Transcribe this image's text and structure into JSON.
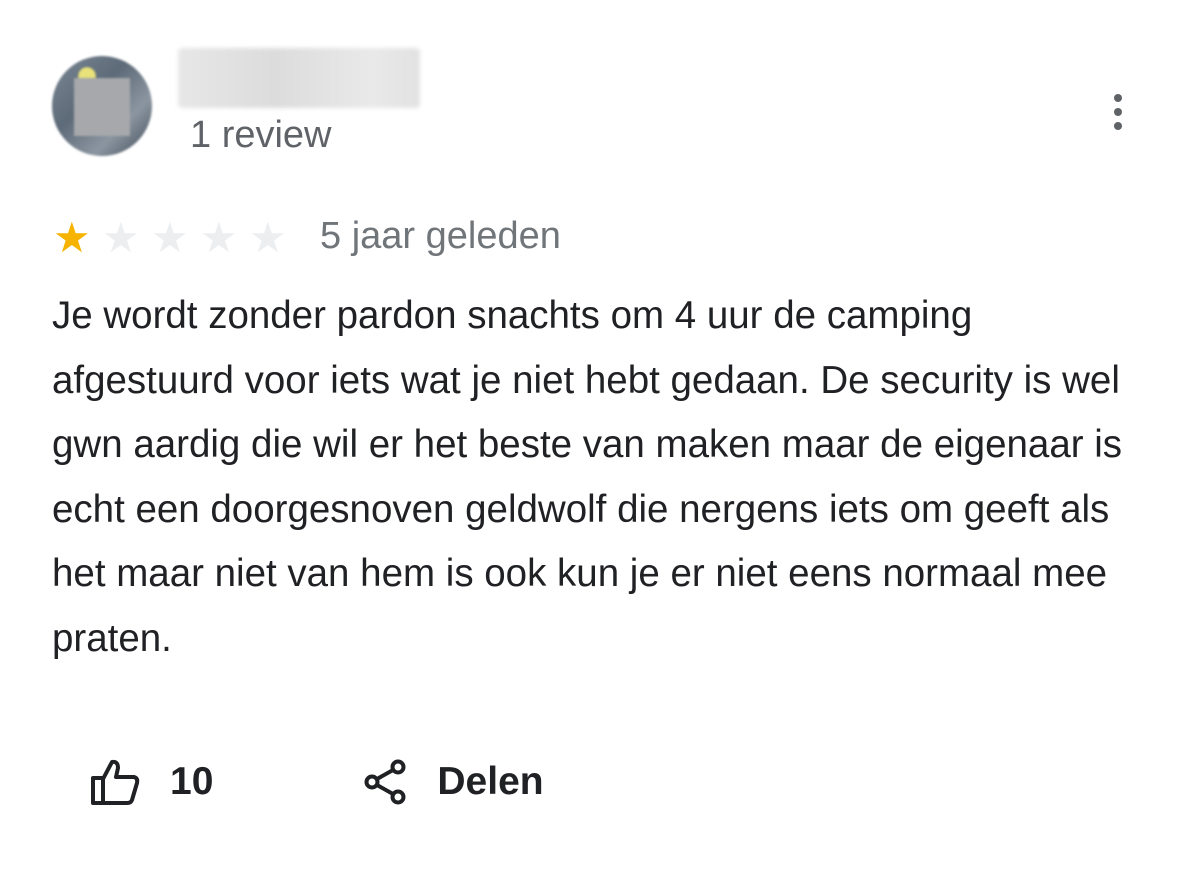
{
  "reviewer": {
    "avatar_icon": "blurred-profile-photo",
    "review_count": "1 review"
  },
  "menu_icon": "more-vert-icon",
  "rating": {
    "stars": 1,
    "max_stars": 5,
    "filled_color": "#f6b400",
    "empty_color": "#eceef0"
  },
  "date": "5 jaar geleden",
  "review_text": "Je wordt zonder pardon snachts om 4 uur de camping afgestuurd voor iets wat je niet hebt gedaan. De security is wel gwn aardig die wil er het beste van maken maar de eigenaar is echt een doorgesnoven geldwolf die nergens iets om geeft als het maar niet van hem is ook kun je er niet eens normaal mee praten.",
  "actions": {
    "like_icon": "thumbs-up-icon",
    "like_count": "10",
    "share_icon": "share-icon",
    "share_label": "Delen"
  }
}
